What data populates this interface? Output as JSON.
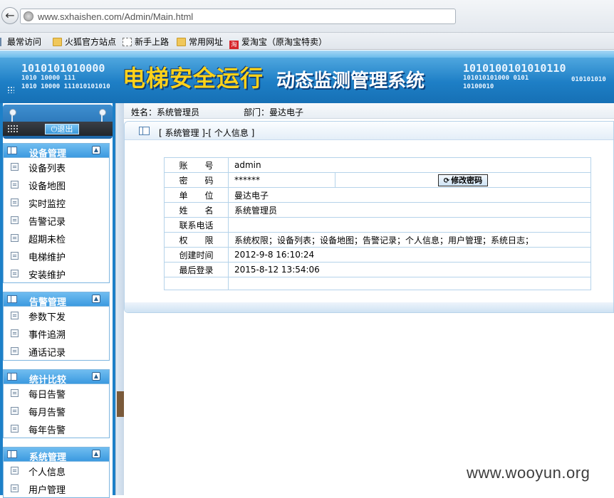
{
  "browser": {
    "url": "www.sxhaishen.com/Admin/Main.html",
    "bookmarks": [
      "最常访问",
      "火狐官方站点",
      "新手上路",
      "常用网址",
      "爱淘宝（原淘宝特卖）"
    ],
    "taobao_glyph": "淘"
  },
  "banner": {
    "title": "电梯安全运行",
    "subtitle": "动态监测管理系统",
    "binary_left_1": "1010101010000",
    "binary_left_2": "1010 10000 111",
    "binary_left_3": "1010 10000 111010101010",
    "binary_right_1": "1010100101010110",
    "binary_right_2": "101010101000   0101",
    "binary_right_3": "10100010",
    "binary_right_4": "010101010"
  },
  "sidebar": {
    "logout_label": "退出",
    "groups": [
      {
        "title": "设备管理",
        "items": [
          "设备列表",
          "设备地图",
          "实时监控",
          "告警记录",
          "超期未检",
          "电梯维护",
          "安装维护"
        ]
      },
      {
        "title": "告警管理",
        "items": [
          "参数下发",
          "事件追溯",
          "通话记录"
        ]
      },
      {
        "title": "统计比较",
        "items": [
          "每日告警",
          "每月告警",
          "每年告警"
        ]
      },
      {
        "title": "系统管理",
        "items": [
          "个人信息",
          "用户管理"
        ]
      }
    ]
  },
  "infobar": {
    "name": "姓名：系统管理员",
    "dept": "部门：曼达电子"
  },
  "panel": {
    "title": "[ 系统管理 ]-[ 个人信息 ]",
    "change_password_label": "修改密码",
    "rows": [
      {
        "label": "账　　号",
        "value": "admin"
      },
      {
        "label": "密　　码",
        "value": "******"
      },
      {
        "label": "单　　位",
        "value": "曼达电子"
      },
      {
        "label": "姓　　名",
        "value": "系统管理员"
      },
      {
        "label": "联系电话",
        "value": ""
      },
      {
        "label": "权　　限",
        "value": "系统权限；设备列表；设备地图；告警记录；个人信息；用户管理；系统日志；"
      },
      {
        "label": "创建时间",
        "value": "2012-9-8 16:10:24"
      },
      {
        "label": "最后登录",
        "value": "2015-8-12 13:54:06"
      },
      {
        "label": "",
        "value": ""
      }
    ]
  },
  "watermark": "www.wooyun.org"
}
